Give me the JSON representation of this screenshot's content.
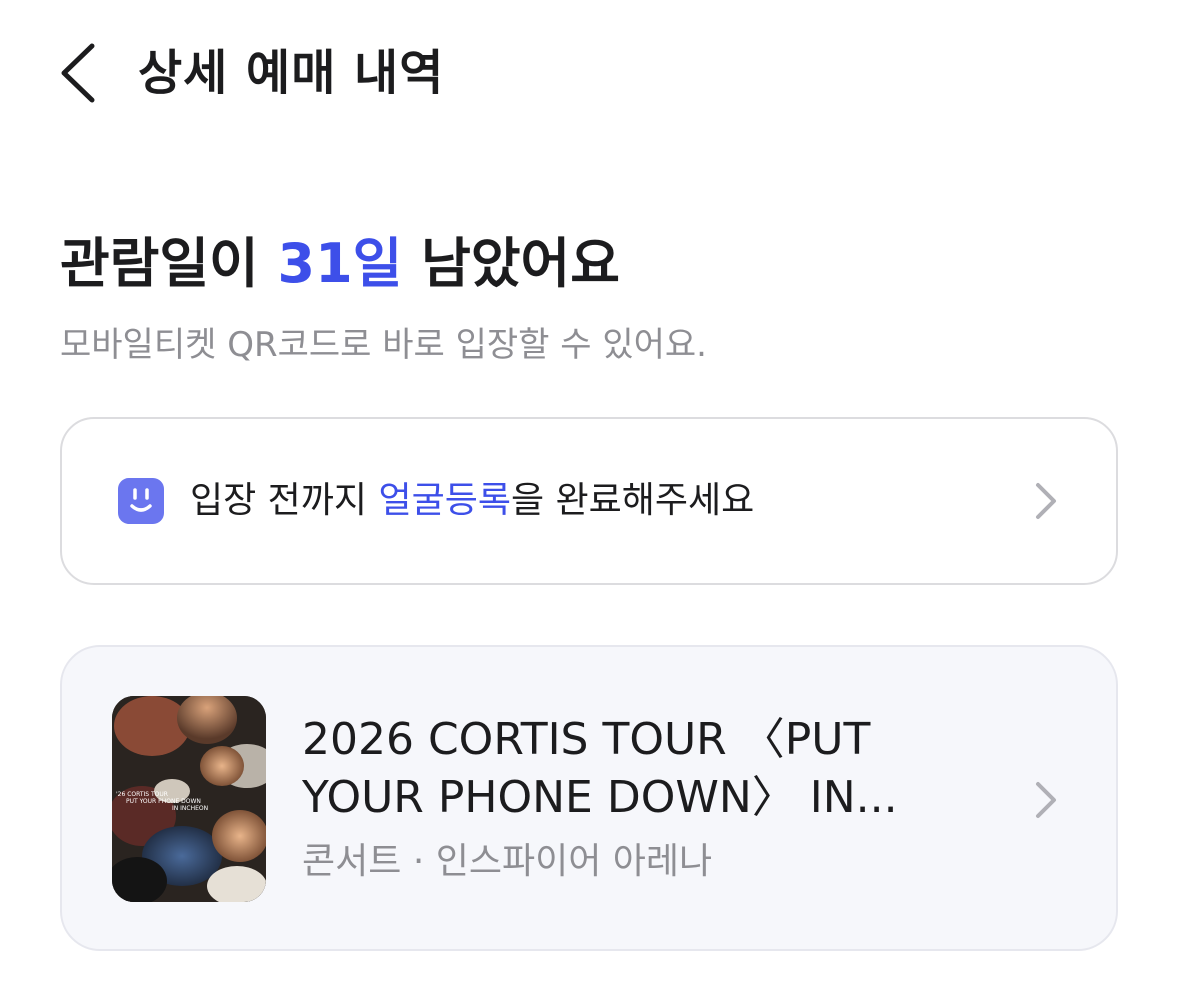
{
  "header": {
    "title": "상세 예매 내역",
    "back_icon": "chevron-left-icon"
  },
  "status": {
    "headline_prefix": "관람일이 ",
    "days_remaining": "31일",
    "headline_suffix": " 남았어요",
    "subtext": "모바일티켓 QR코드로 바로 입장할 수 있어요."
  },
  "face_registration": {
    "icon": "face-icon",
    "text_prefix": "입장 전까지 ",
    "text_highlight": "얼굴등록",
    "text_suffix": "을 완료해주세요"
  },
  "event": {
    "title_line1": "2026 CORTIS TOUR 〈PUT",
    "title_line2": "YOUR PHONE DOWN〉 IN...",
    "category": "콘서트",
    "separator": " · ",
    "venue": "인스파이어 아레나",
    "poster_text_line1": "'26 CORTIS TOUR",
    "poster_text_line2": "PUT YOUR PHONE DOWN",
    "poster_text_line3": "IN INCHEON"
  },
  "colors": {
    "accent": "#3d4fe9",
    "face_icon_bg": "#6b76ef",
    "secondary_text": "#8e8e93",
    "card_border": "#dcdcdf",
    "event_card_bg": "#f6f7fb"
  }
}
